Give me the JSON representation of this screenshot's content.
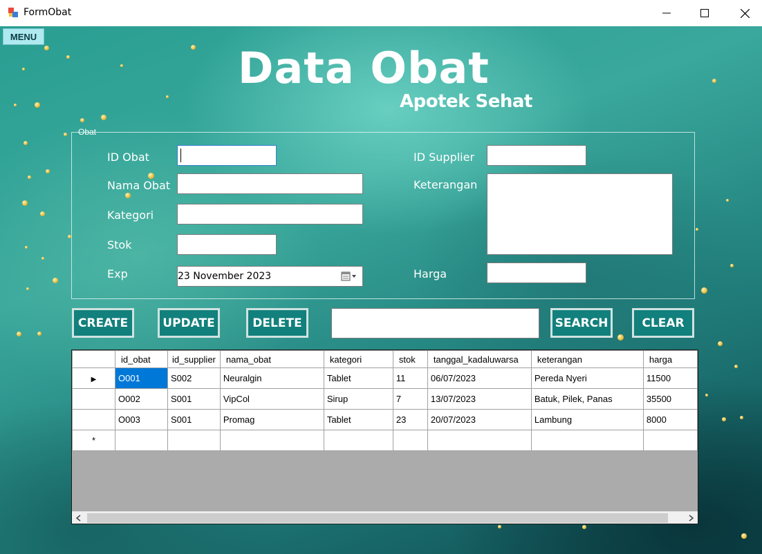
{
  "window": {
    "title": "FormObat"
  },
  "menu": {
    "label": "MENU"
  },
  "header": {
    "title": "Data Obat",
    "subtitle": "Apotek Sehat"
  },
  "group": {
    "label": "Obat"
  },
  "form": {
    "labels": {
      "id_obat": "ID Obat",
      "nama_obat": "Nama Obat",
      "kategori": "Kategori",
      "stok": "Stok",
      "exp": "Exp",
      "id_supplier": "ID Supplier",
      "keterangan": "Keterangan",
      "harga": "Harga"
    },
    "values": {
      "id_obat": "",
      "nama_obat": "",
      "kategori": "",
      "stok": "",
      "exp": "23 November  2023",
      "id_supplier": "",
      "keterangan": "",
      "harga": ""
    }
  },
  "actions": {
    "create": "CREATE",
    "update": "UPDATE",
    "delete": "DELETE",
    "search": "SEARCH",
    "clear": "CLEAR",
    "search_value": ""
  },
  "grid": {
    "columns": [
      "id_obat",
      "id_supplier",
      "nama_obat",
      "kategori",
      "stok",
      "tanggal_kadaluwarsa",
      "keterangan",
      "harga"
    ],
    "rows": [
      [
        "O001",
        "S002",
        "Neuralgin",
        "Tablet",
        "11",
        "06/07/2023",
        "Pereda Nyeri",
        "11500"
      ],
      [
        "O002",
        "S001",
        "VipCol",
        "Sirup",
        "7",
        "13/07/2023",
        "Batuk, Pilek, Panas",
        "35500"
      ],
      [
        "O003",
        "S001",
        "Promag",
        "Tablet",
        "23",
        "20/07/2023",
        "Lambung",
        "8000"
      ]
    ],
    "current_row_marker": "▶",
    "new_row_marker": "*"
  },
  "colors": {
    "accent": "#12807c",
    "selection": "#0078d7"
  },
  "icons": [
    "app-icon",
    "minimize-icon",
    "maximize-icon",
    "close-icon",
    "calendar-dropdown-icon",
    "scroll-left-icon",
    "scroll-right-icon"
  ]
}
